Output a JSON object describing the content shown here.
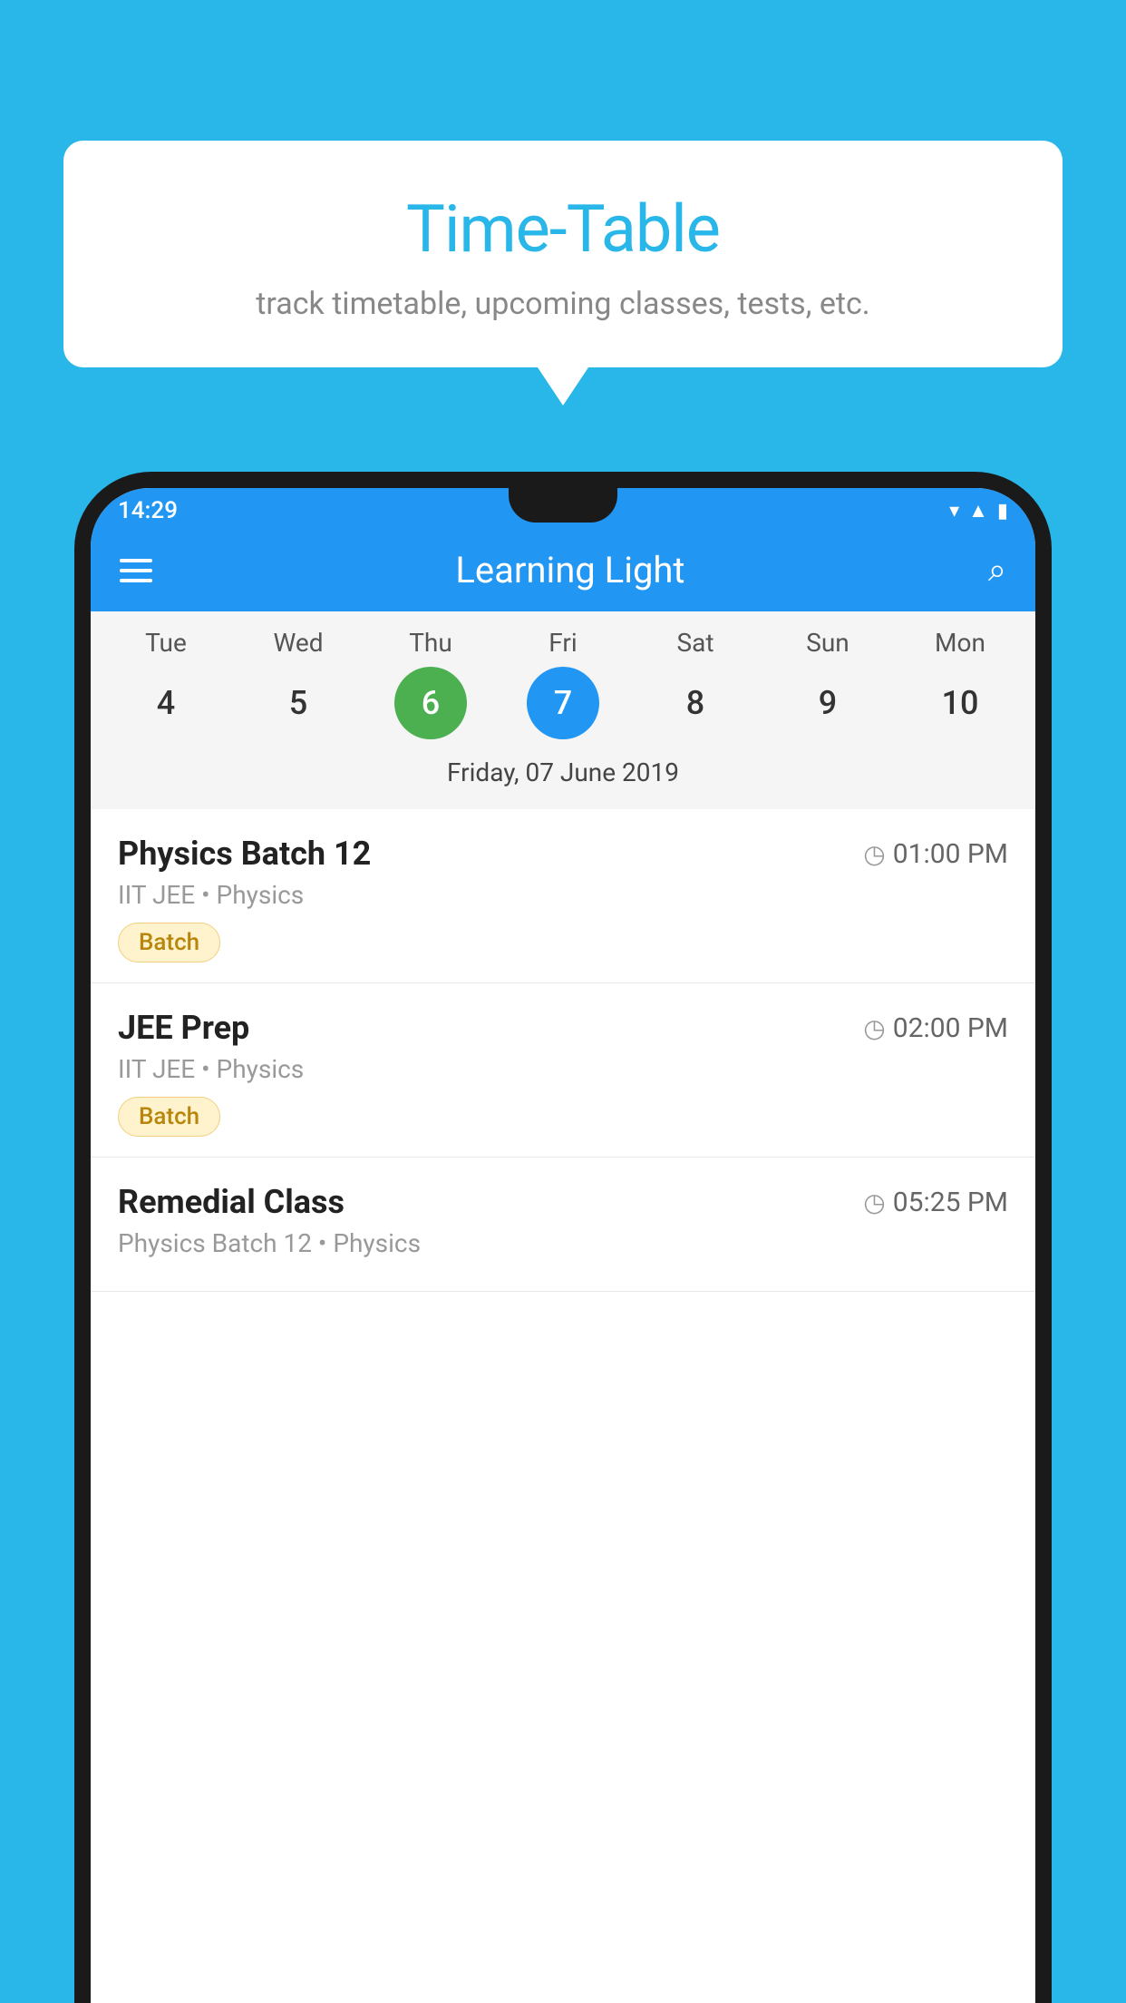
{
  "background": {
    "color": "#29b6e8"
  },
  "bubble": {
    "title": "Time-Table",
    "subtitle": "track timetable, upcoming classes, tests, etc."
  },
  "phone": {
    "status_bar": {
      "time": "14:29"
    },
    "app_bar": {
      "title": "Learning Light"
    },
    "calendar": {
      "days": [
        "Tue",
        "Wed",
        "Thu",
        "Fri",
        "Sat",
        "Sun",
        "Mon"
      ],
      "dates": [
        4,
        5,
        6,
        7,
        8,
        9,
        10
      ],
      "today_index": 2,
      "selected_index": 3,
      "selected_label": "Friday, 07 June 2019"
    },
    "schedule": [
      {
        "title": "Physics Batch 12",
        "time": "01:00 PM",
        "sub": "IIT JEE • Physics",
        "tag": "Batch"
      },
      {
        "title": "JEE Prep",
        "time": "02:00 PM",
        "sub": "IIT JEE • Physics",
        "tag": "Batch"
      },
      {
        "title": "Remedial Class",
        "time": "05:25 PM",
        "sub": "Physics Batch 12 • Physics",
        "tag": ""
      }
    ]
  }
}
